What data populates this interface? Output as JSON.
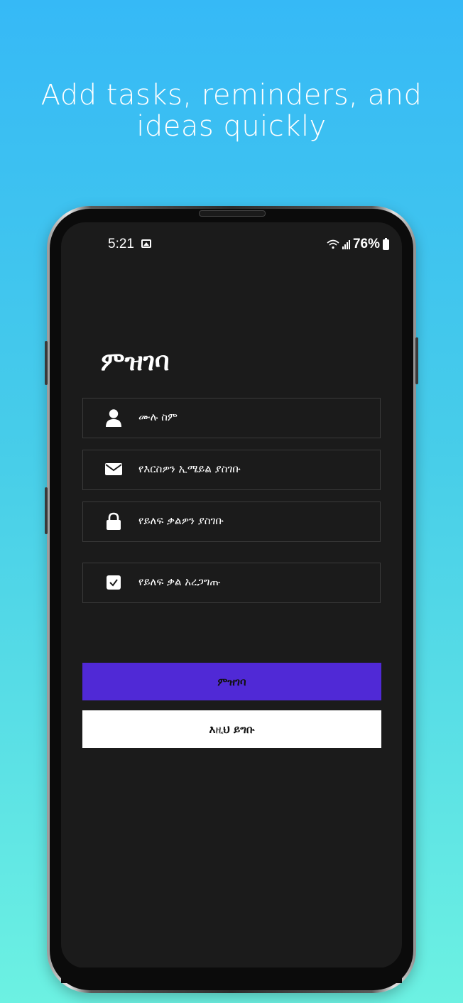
{
  "promo": {
    "headline_line1": "Add tasks, reminders, and",
    "headline_line2": "ideas quickly"
  },
  "status_bar": {
    "time": "5:21",
    "battery": "76%"
  },
  "form": {
    "title": "ምዝገባ",
    "fields": [
      {
        "label": "ሙሉ ስም",
        "icon": "user-icon"
      },
      {
        "label": "የእርስዎን ኢሜይል ያስገቡ",
        "icon": "mail-icon"
      },
      {
        "label": "የይለፍ ቃልዎን ያስገቡ",
        "icon": "lock-icon"
      },
      {
        "label": "የይለፍ ቃል አረጋግጡ",
        "icon": "check-icon"
      }
    ],
    "register_button": "ምዝገባ",
    "login_button": "እዚህ ይግቡ"
  },
  "colors": {
    "accent": "#5029d6",
    "screen_bg": "#1b1b1b",
    "bg_top": "#36b9f6",
    "bg_bottom": "#6cf1e2"
  }
}
